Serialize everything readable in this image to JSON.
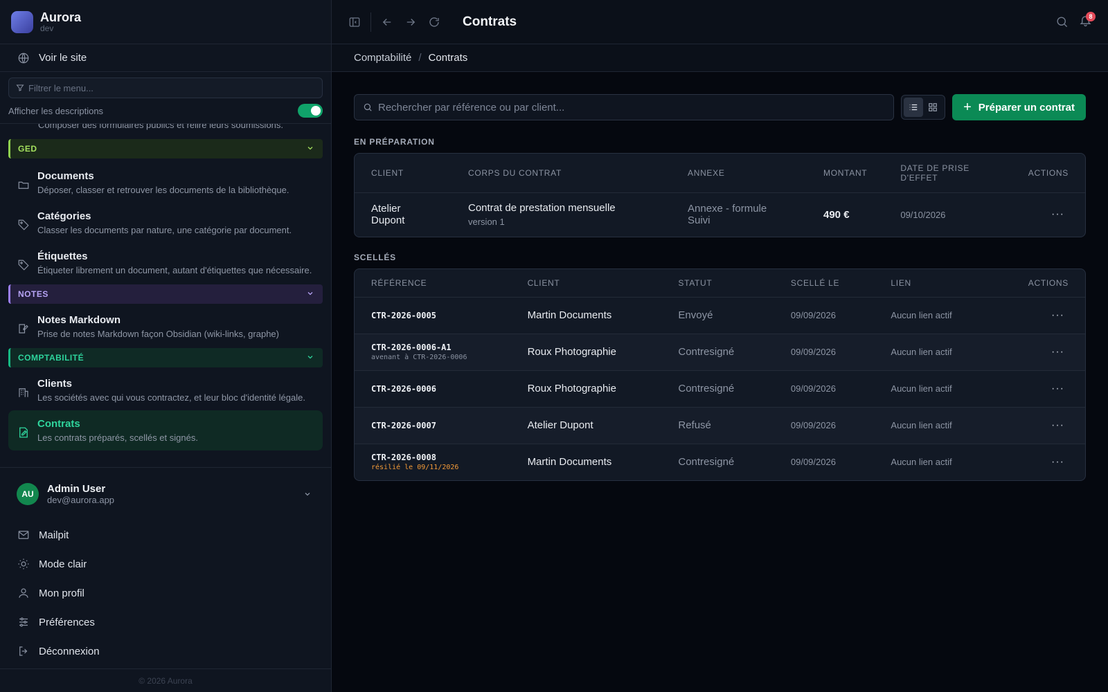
{
  "brand": {
    "name": "Aurora",
    "env": "dev"
  },
  "sidebar": {
    "site_link": "Voir le site",
    "filter_placeholder": "Filtrer le menu...",
    "show_descriptions": "Afficher les descriptions",
    "cut_desc": "Composer des formulaires publics et relire leurs soumissions.",
    "sections": {
      "ged": "GED",
      "notes": "NOTES",
      "compta": "COMPTABILITÉ"
    },
    "items": {
      "documents": {
        "title": "Documents",
        "desc": "Déposer, classer et retrouver les documents de la bibliothèque."
      },
      "categories": {
        "title": "Catégories",
        "desc": "Classer les documents par nature, une catégorie par document."
      },
      "etiquettes": {
        "title": "Étiquettes",
        "desc": "Étiqueter librement un document, autant d'étiquettes que nécessaire."
      },
      "notes_md": {
        "title": "Notes Markdown",
        "desc": "Prise de notes Markdown façon Obsidian (wiki-links, graphe)"
      },
      "clients": {
        "title": "Clients",
        "desc": "Les sociétés avec qui vous contractez, et leur bloc d'identité légale."
      },
      "contrats": {
        "title": "Contrats",
        "desc": "Les contrats préparés, scellés et signés."
      }
    },
    "user": {
      "initials": "AU",
      "name": "Admin User",
      "email": "dev@aurora.app"
    },
    "bottom": {
      "mailpit": "Mailpit",
      "light_mode": "Mode clair",
      "profile": "Mon profil",
      "preferences": "Préférences",
      "logout": "Déconnexion"
    },
    "copyright": "© 2026 Aurora"
  },
  "topbar": {
    "title": "Contrats",
    "notif_count": "8"
  },
  "breadcrumb": {
    "parent": "Comptabilité",
    "sep": "/",
    "current": "Contrats"
  },
  "toolbar": {
    "search_placeholder": "Rechercher par référence ou par client...",
    "new_button": "Préparer un contrat"
  },
  "preparation": {
    "label": "EN PRÉPARATION",
    "headers": {
      "client": "CLIENT",
      "body": "CORPS DU CONTRAT",
      "annex": "ANNEXE",
      "amount": "MONTANT",
      "date1": "DATE DE PRISE",
      "date2": "D'EFFET",
      "actions": "ACTIONS"
    },
    "rows": [
      {
        "client1": "Atelier",
        "client2": "Dupont",
        "body": "Contrat de prestation mensuelle",
        "version": "version 1",
        "annex1": "Annexe - formule",
        "annex2": "Suivi",
        "amount": "490 €",
        "date": "09/10/2026"
      }
    ]
  },
  "sealed": {
    "label": "SCELLÉS",
    "headers": {
      "ref": "RÉFÉRENCE",
      "client": "CLIENT",
      "status": "STATUT",
      "sealed_on": "SCELLÉ LE",
      "link": "LIEN",
      "actions": "ACTIONS"
    },
    "rows": [
      {
        "ref": "CTR-2026-0005",
        "sub": "",
        "client": "Martin Documents",
        "status": "Envoyé",
        "date": "09/09/2026",
        "link": "Aucun lien actif"
      },
      {
        "ref": "CTR-2026-0006-A1",
        "sub": "avenant à CTR-2026-0006",
        "client": "Roux Photographie",
        "status": "Contresigné",
        "date": "09/09/2026",
        "link": "Aucun lien actif"
      },
      {
        "ref": "CTR-2026-0006",
        "sub": "",
        "client": "Roux Photographie",
        "status": "Contresigné",
        "date": "09/09/2026",
        "link": "Aucun lien actif"
      },
      {
        "ref": "CTR-2026-0007",
        "sub": "",
        "client": "Atelier Dupont",
        "status": "Refusé",
        "date": "09/09/2026",
        "link": "Aucun lien actif"
      },
      {
        "ref": "CTR-2026-0008",
        "warn": "résilié le 09/11/2026",
        "client": "Martin Documents",
        "status": "Contresigné",
        "date": "09/09/2026",
        "link": "Aucun lien actif"
      }
    ]
  },
  "actions_glyph": "···"
}
